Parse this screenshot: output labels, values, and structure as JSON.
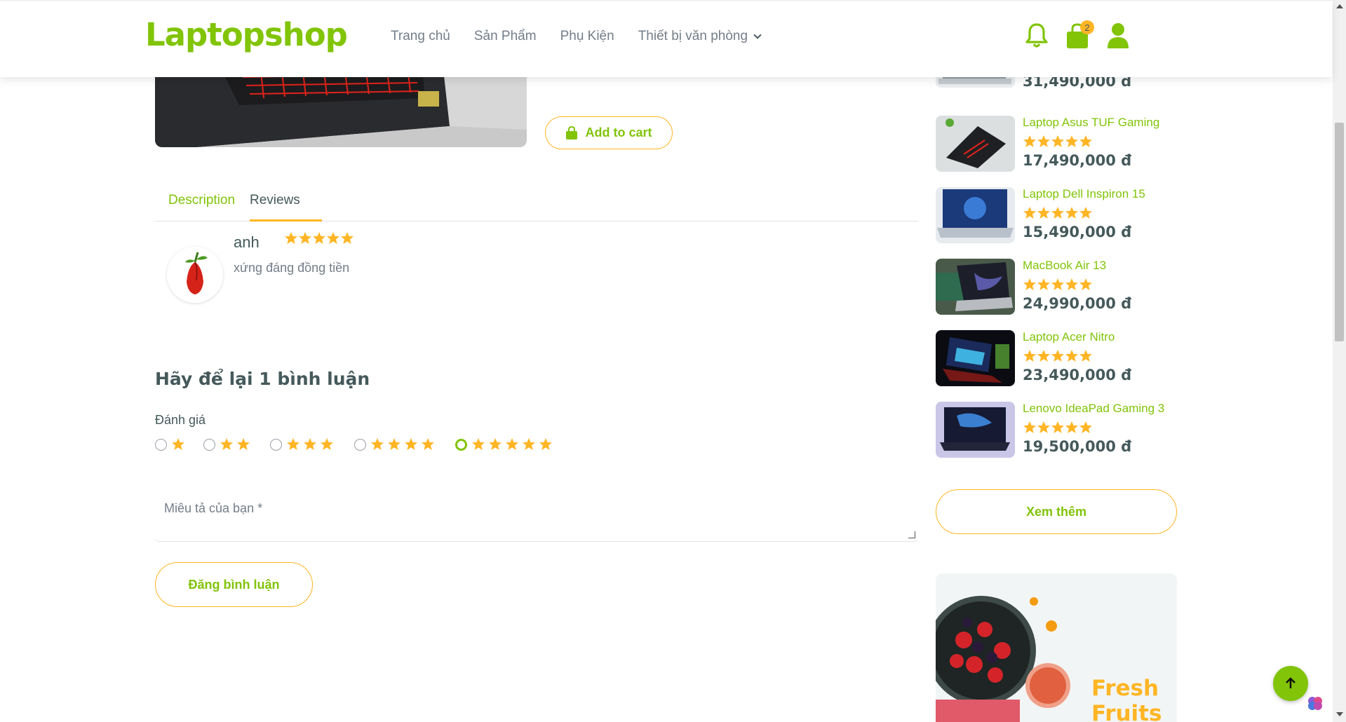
{
  "header": {
    "logo": "Laptopshop",
    "nav": [
      "Trang chủ",
      "Sản Phẩm",
      "Phụ Kiện",
      "Thiết bị văn phòng"
    ],
    "cart_count": "2"
  },
  "product": {
    "add_to_cart": "Add to cart"
  },
  "tabs": {
    "description": "Description",
    "reviews": "Reviews"
  },
  "review": {
    "name": "anh",
    "rating": 5,
    "text": "xứng đáng đồng tiền"
  },
  "form": {
    "title": "Hãy để lại 1 bình luận",
    "rating_label": "Đánh giá",
    "rating_options": [
      1,
      2,
      3,
      4,
      5
    ],
    "selected_rating": 5,
    "textarea_placeholder": "Miêu tả của bạn *",
    "submit": "Đăng bình luận"
  },
  "sidebar": {
    "items": [
      {
        "title": "",
        "price": "31,490,000 đ",
        "rating": 5
      },
      {
        "title": "Laptop Asus TUF Gaming",
        "price": "17,490,000 đ",
        "rating": 5
      },
      {
        "title": "Laptop Dell Inspiron 15",
        "price": "15,490,000 đ",
        "rating": 5
      },
      {
        "title": "MacBook Air 13",
        "price": "24,990,000 đ",
        "rating": 5
      },
      {
        "title": "Laptop Acer Nitro",
        "price": "23,490,000 đ",
        "rating": 5
      },
      {
        "title": "Lenovo IdeaPad Gaming 3",
        "price": "19,500,000 đ",
        "rating": 5
      }
    ],
    "more_button": "Xem thêm",
    "banner_line1": "Fresh",
    "banner_line2": "Fruits"
  },
  "colors": {
    "primary": "#81c408",
    "secondary": "#ffb524",
    "text": "#45595b"
  },
  "icons": [
    "bell-icon",
    "shopping-bag-icon",
    "user-icon",
    "chevron-down-icon",
    "star-icon",
    "arrow-up-icon"
  ]
}
